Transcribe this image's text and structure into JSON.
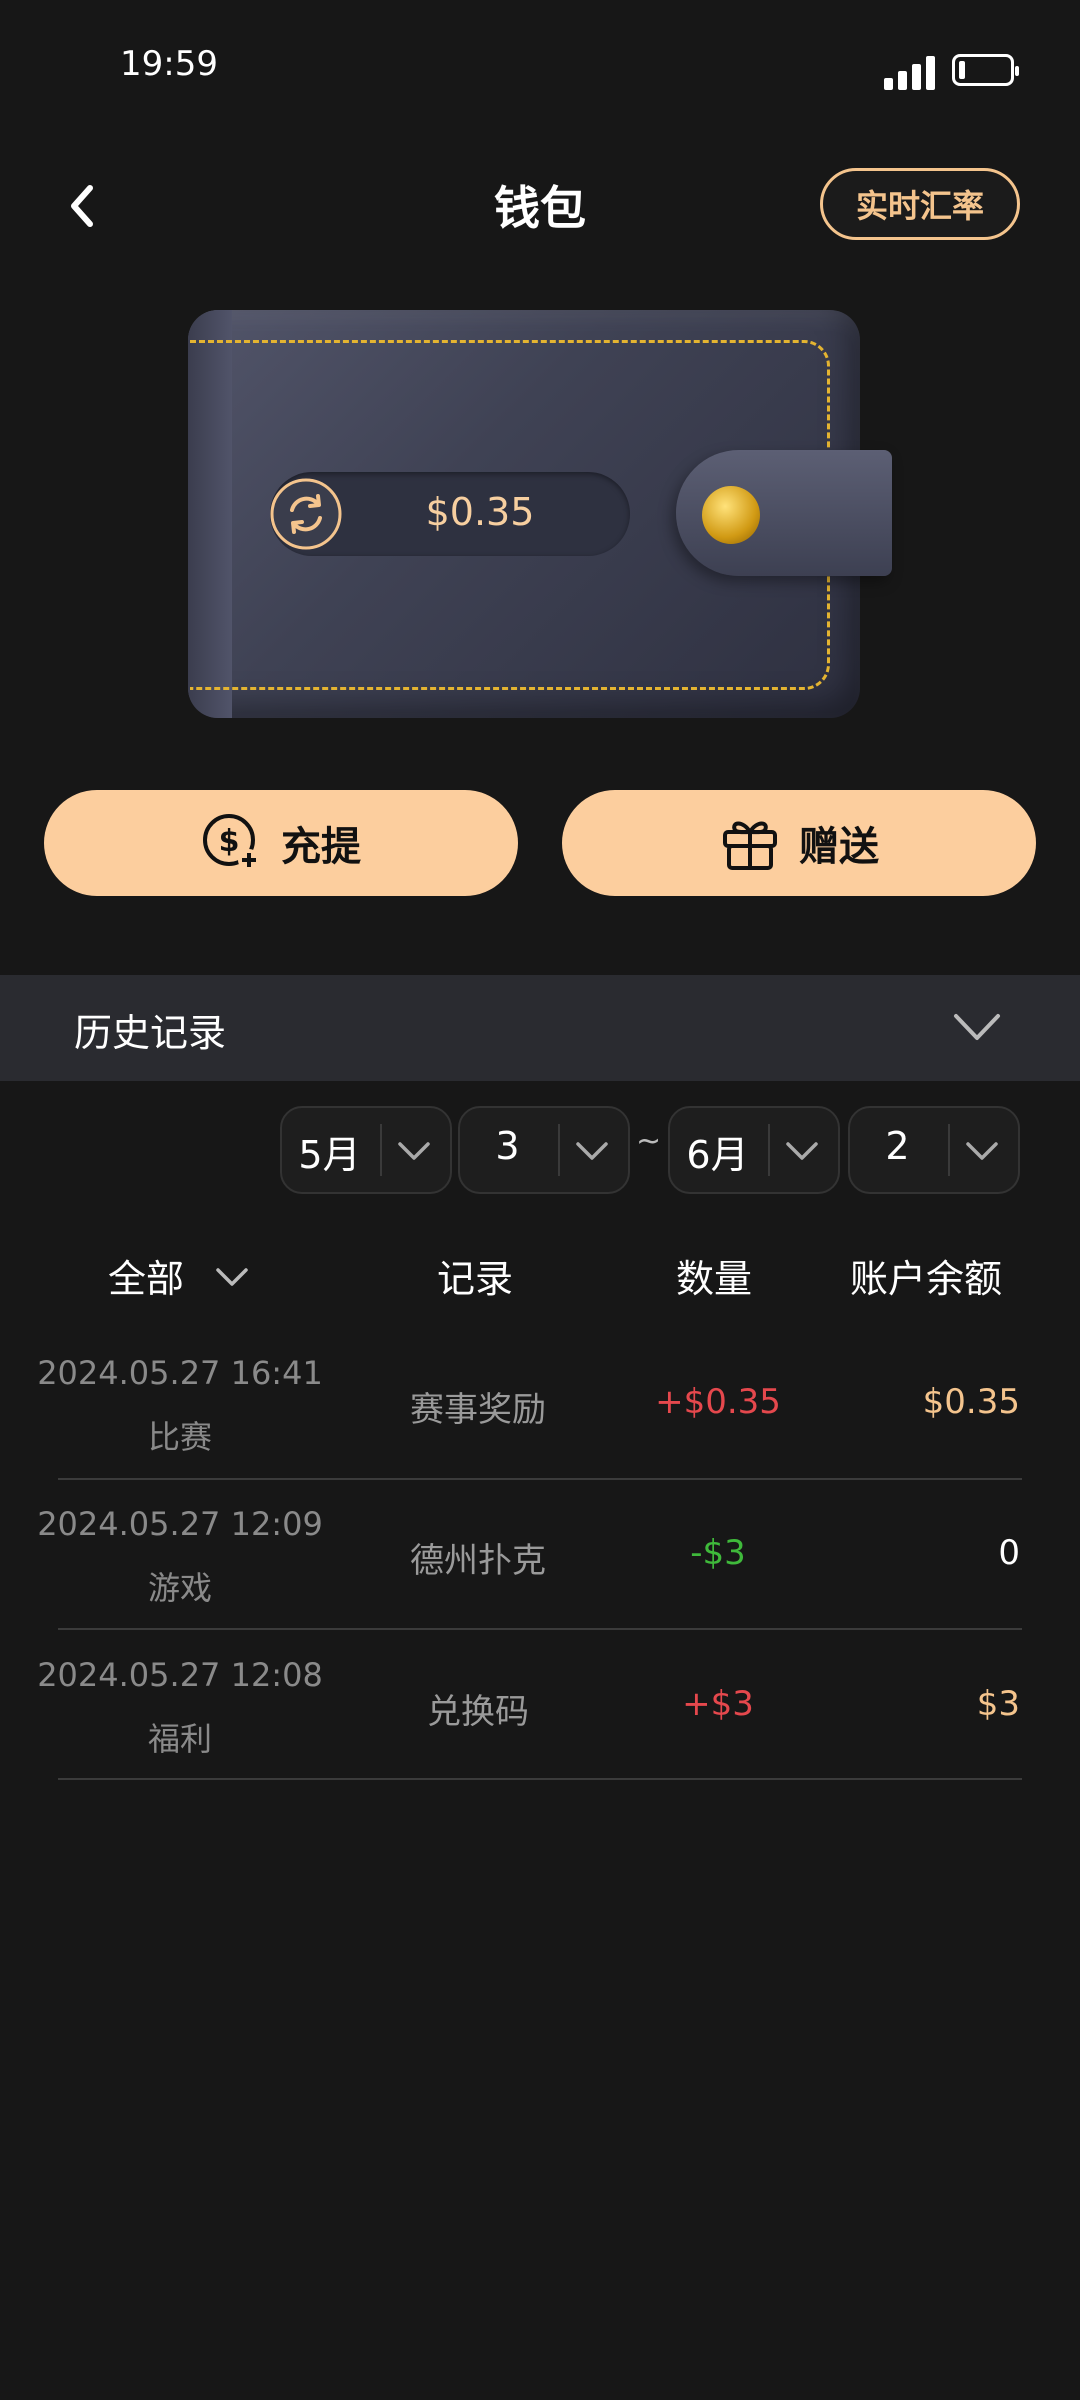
{
  "status": {
    "time": "19:59"
  },
  "header": {
    "title": "钱包",
    "rate_button": "实时汇率"
  },
  "wallet": {
    "balance": "$0.35"
  },
  "actions": {
    "topup_label": "充提",
    "gift_label": "赠送"
  },
  "history": {
    "label": "历史记录",
    "date_range": {
      "start_month": "5月",
      "start_day": "3",
      "separator": "~",
      "end_month": "6月",
      "end_day": "2"
    }
  },
  "table": {
    "headers": {
      "filter": "全部",
      "record": "记录",
      "amount": "数量",
      "balance": "账户余额"
    },
    "rows": [
      {
        "datetime": "2024.05.27 16:41",
        "category": "比赛",
        "record": "赛事奖励",
        "amount": "+$0.35",
        "balance": "$0.35"
      },
      {
        "datetime": "2024.05.27 12:09",
        "category": "游戏",
        "record": "德州扑克",
        "amount": "-$3",
        "balance": "0"
      },
      {
        "datetime": "2024.05.27 12:08",
        "category": "福利",
        "record": "兑换码",
        "amount": "+$3",
        "balance": "$3"
      }
    ]
  },
  "colors": {
    "accent": "#FCCE9E",
    "positive": "#E5484D",
    "negative": "#3FB93B",
    "balance_gold": "#F4C48D"
  }
}
